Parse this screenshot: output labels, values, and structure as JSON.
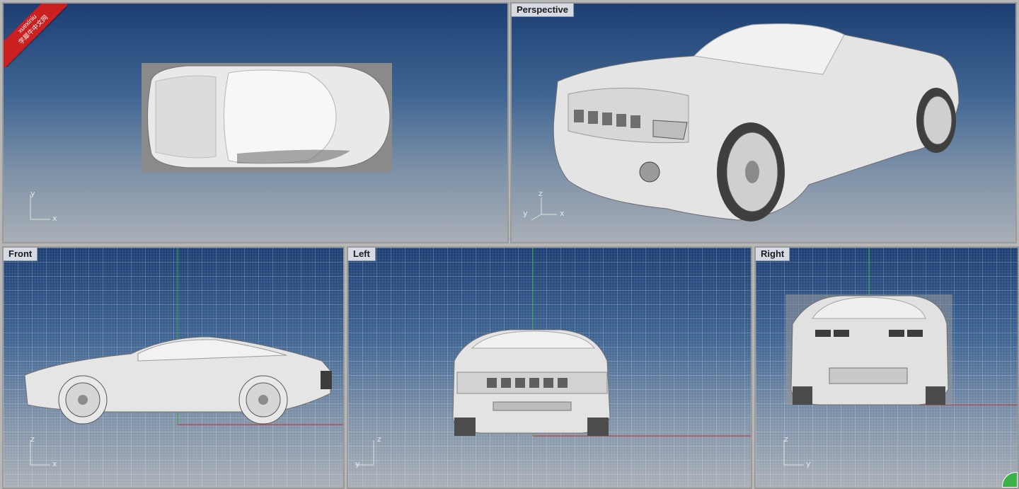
{
  "viewports": {
    "top": {
      "label": "",
      "axes": [
        "y",
        "x"
      ]
    },
    "perspective": {
      "label": "Perspective",
      "axes": [
        "z",
        "y",
        "x"
      ]
    },
    "front": {
      "label": "Front",
      "axes": [
        "z",
        "x"
      ]
    },
    "left": {
      "label": "Left",
      "axes": [
        "z",
        "y"
      ]
    },
    "right": {
      "label": "Right",
      "axes": [
        "z",
        "y"
      ]
    }
  },
  "watermark": {
    "line1": "xuexiniu",
    "line2": "学犀牛中文网"
  },
  "colors": {
    "x_axis": "#c0302a",
    "y_axis": "#3aa83a",
    "car_body": "#e6e6e6",
    "car_shadow": "#8e8e8e",
    "viewport_border": "#9a9a9a"
  }
}
